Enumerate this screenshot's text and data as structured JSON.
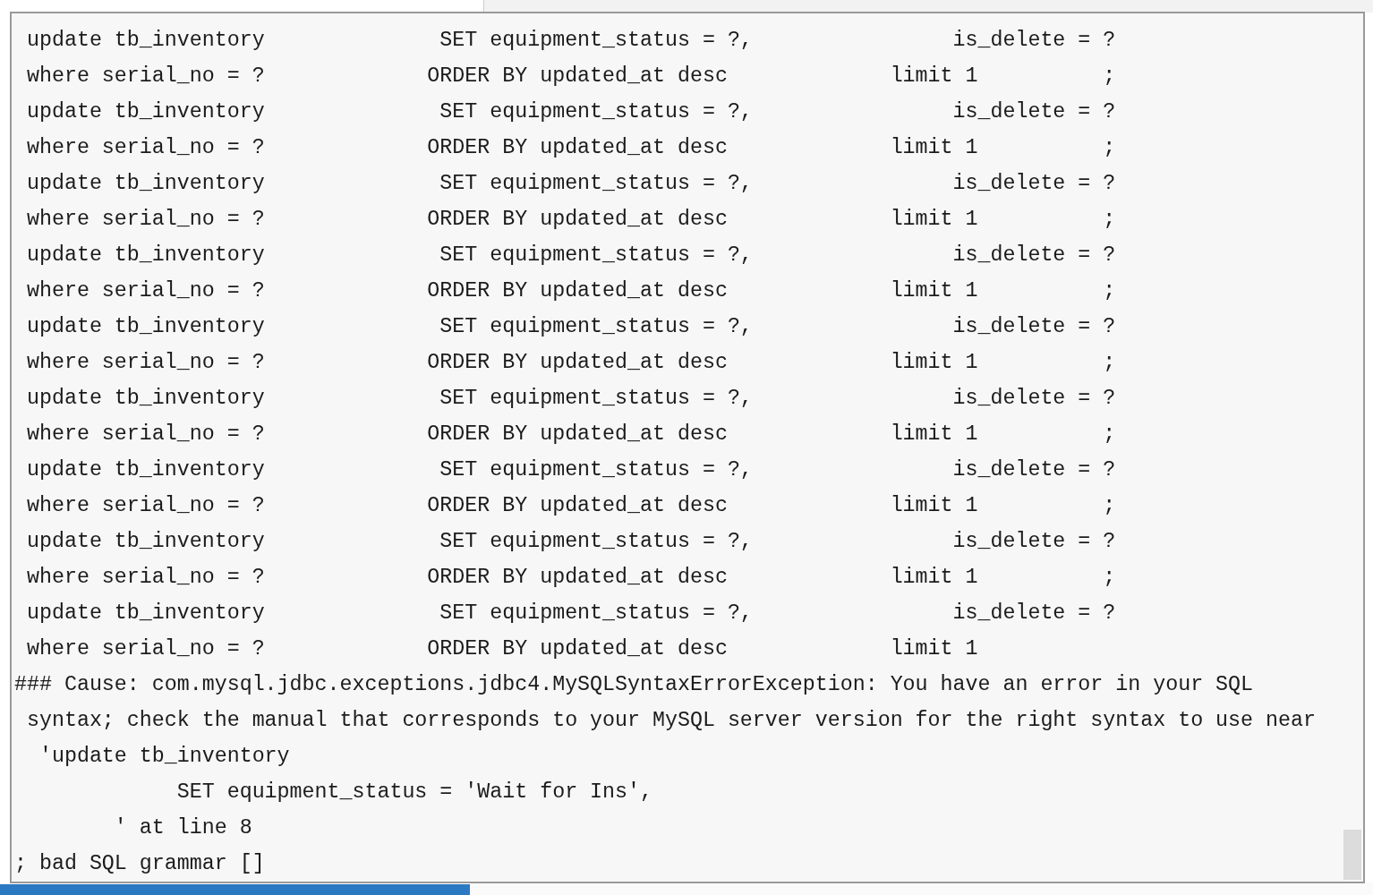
{
  "tooltip": {
    "lines": [
      " update tb_inventory              SET equipment_status = ?,                is_delete = ?",
      " where serial_no = ?             ORDER BY updated_at desc             limit 1          ;",
      " update tb_inventory              SET equipment_status = ?,                is_delete = ?",
      " where serial_no = ?             ORDER BY updated_at desc             limit 1          ;",
      " update tb_inventory              SET equipment_status = ?,                is_delete = ?",
      " where serial_no = ?             ORDER BY updated_at desc             limit 1          ;",
      " update tb_inventory              SET equipment_status = ?,                is_delete = ?",
      " where serial_no = ?             ORDER BY updated_at desc             limit 1          ;",
      " update tb_inventory              SET equipment_status = ?,                is_delete = ?",
      " where serial_no = ?             ORDER BY updated_at desc             limit 1          ;",
      " update tb_inventory              SET equipment_status = ?,                is_delete = ?",
      " where serial_no = ?             ORDER BY updated_at desc             limit 1          ;",
      " update tb_inventory              SET equipment_status = ?,                is_delete = ?",
      " where serial_no = ?             ORDER BY updated_at desc             limit 1          ;",
      " update tb_inventory              SET equipment_status = ?,                is_delete = ?",
      " where serial_no = ?             ORDER BY updated_at desc             limit 1          ;",
      " update tb_inventory              SET equipment_status = ?,                is_delete = ?",
      " where serial_no = ?             ORDER BY updated_at desc             limit 1",
      "### Cause: com.mysql.jdbc.exceptions.jdbc4.MySQLSyntaxErrorException: You have an error in your SQL",
      " syntax; check the manual that corresponds to your MySQL server version for the right syntax to use near",
      "  'update tb_inventory",
      "             SET equipment_status = 'Wait for Ins',",
      "        ' at line 8",
      "; bad SQL grammar []"
    ]
  }
}
